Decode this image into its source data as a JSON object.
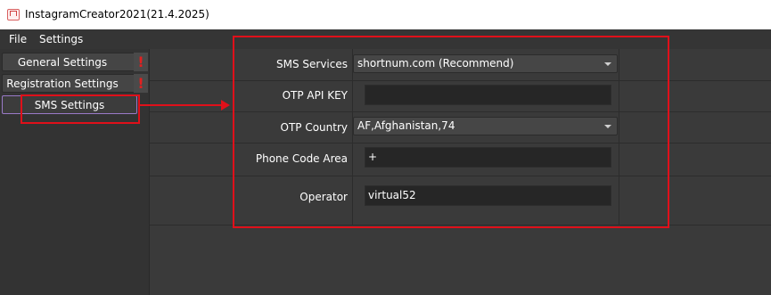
{
  "window": {
    "title": "InstagramCreator2021(21.4.2025)"
  },
  "menu": {
    "items": [
      "File",
      "Settings"
    ]
  },
  "sidebar": {
    "items": [
      {
        "label": "General Settings",
        "warning": "!"
      },
      {
        "label": "Registration Settings",
        "warning": "!"
      },
      {
        "label": "SMS Settings",
        "active": true
      }
    ]
  },
  "form": {
    "sms_services": {
      "label": "SMS Services",
      "value": "shortnum.com (Recommend)"
    },
    "otp_api_key": {
      "label": "OTP API KEY",
      "value": ""
    },
    "otp_country": {
      "label": "OTP Country",
      "value": "AF,Afghanistan,74"
    },
    "phone_code_area": {
      "label": "Phone Code Area",
      "value": "+"
    },
    "operator": {
      "label": "Operator",
      "value": "virtual52"
    }
  },
  "colors": {
    "annotation": "#e0101a",
    "active_border": "#9a7ac8",
    "warning": "#e22020"
  }
}
